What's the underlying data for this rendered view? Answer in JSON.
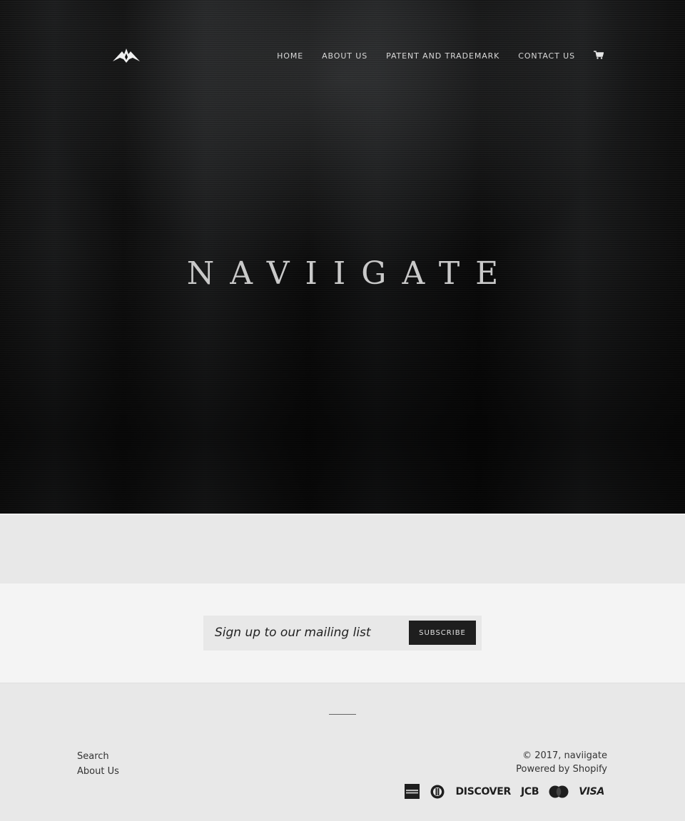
{
  "header": {
    "logo_icon": "naviigate-arrow-logo",
    "nav": [
      {
        "label": "Home"
      },
      {
        "label": "About Us"
      },
      {
        "label": "Patent and Trademark"
      },
      {
        "label": "Contact Us"
      }
    ],
    "cart_icon": "shopping-cart-icon"
  },
  "hero": {
    "wordmark": "NAVIIGATE"
  },
  "newsletter": {
    "placeholder": "Sign up to our mailing list",
    "value": "",
    "button_label": "Subscribe"
  },
  "footer": {
    "links": [
      {
        "label": "Search"
      },
      {
        "label": "About Us"
      }
    ],
    "copyright": "© 2017, naviigate",
    "powered_by": "Powered by Shopify",
    "payment_icons": [
      {
        "name": "american-express-icon",
        "label": "AMERICAN EXPRESS"
      },
      {
        "name": "diners-club-icon",
        "label": "Diners"
      },
      {
        "name": "discover-icon",
        "label": "DISCOVER"
      },
      {
        "name": "jcb-icon",
        "label": "JCB"
      },
      {
        "name": "mastercard-icon",
        "label": "MasterCard"
      },
      {
        "name": "visa-icon",
        "label": "VISA"
      }
    ]
  },
  "colors": {
    "hero_bg": "#0d0d0d",
    "nav_text": "#d9d9d9",
    "wordmark": "#c9c9c9",
    "band_bg": "#e8e8e8",
    "newsletter_bg": "#f4f4f4",
    "button_bg": "#1e1e1e"
  }
}
